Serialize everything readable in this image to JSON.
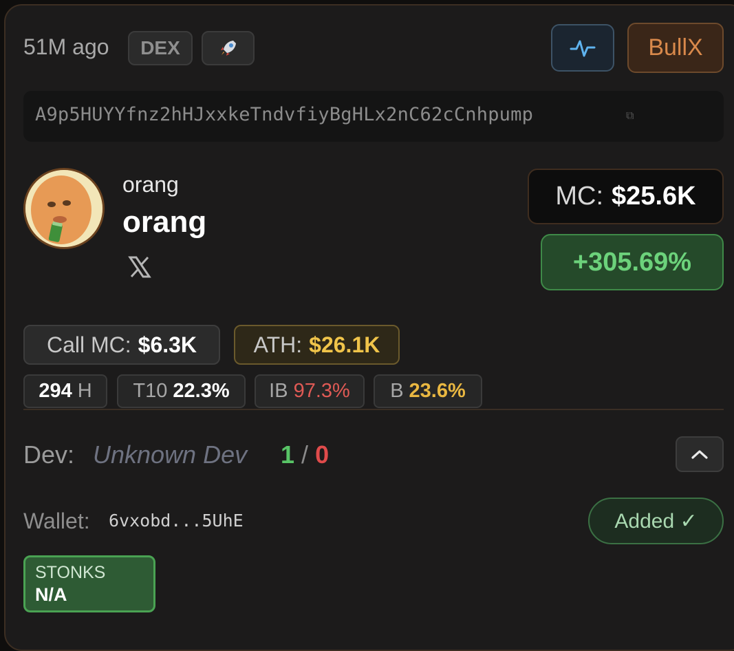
{
  "header": {
    "time_ago": "51M ago",
    "dex_badge": "DEX",
    "rocket_icon": "rocket-emoji",
    "chart_icon": "activity-pulse-icon",
    "bullx_label": "BullX"
  },
  "contract": {
    "address": "A9p5HUYYfnz2hHJxxkeTndvfiyBgHLx2nC62cCnhpump"
  },
  "token": {
    "symbol": "orang",
    "name": "orang",
    "social_icon": "x-logo-icon"
  },
  "market": {
    "mc_label": "MC:",
    "mc_value": "$25.6K",
    "change": "+305.69%"
  },
  "stats": {
    "call_mc_label": "Call MC:",
    "call_mc_value": "$6.3K",
    "ath_label": "ATH:",
    "ath_value": "$26.1K",
    "holders_value": "294",
    "holders_label": "H",
    "top10_label": "T10",
    "top10_value": "22.3%",
    "ib_label": "IB",
    "ib_value": "97.3%",
    "b_label": "B",
    "b_value": "23.6%"
  },
  "dev": {
    "label": "Dev:",
    "name": "Unknown Dev",
    "wins": "1",
    "sep": "/",
    "losses": "0",
    "wallet_label": "Wallet:",
    "wallet_value": "6vxobd...5UhE",
    "added_label": "Added ✓",
    "stonks_title": "STONKS",
    "stonks_value": "N/A"
  },
  "colors": {
    "positive": "#58c466",
    "negative": "#e04b4b",
    "accent_orange": "#d9894b",
    "ath_gold": "#f0c44a"
  }
}
